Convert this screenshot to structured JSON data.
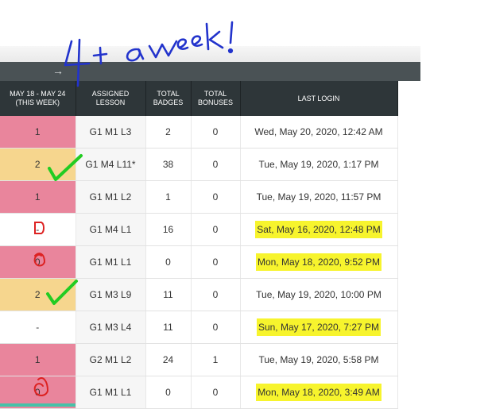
{
  "annotation": {
    "text": "4+ a week!"
  },
  "toolbar": {
    "arrow_icon": "→"
  },
  "table": {
    "headers": [
      "MAY 18 - MAY 24 (THIS WEEK)",
      "ASSIGNED LESSON",
      "TOTAL BADGES",
      "TOTAL BONUSES",
      "LAST LOGIN"
    ],
    "rows": [
      {
        "week": "1",
        "lesson": "G1 M1 L3",
        "badges": "2",
        "bonuses": "0",
        "login": "Wed, May 20, 2020, 12:42 AM",
        "color": "pink",
        "hl": false,
        "mark": ""
      },
      {
        "week": "2",
        "lesson": "G1 M4 L11*",
        "badges": "38",
        "bonuses": "0",
        "login": "Tue, May 19, 2020, 1:17 PM",
        "color": "gold",
        "hl": false,
        "mark": "check"
      },
      {
        "week": "1",
        "lesson": "G1 M1 L2",
        "badges": "1",
        "bonuses": "0",
        "login": "Tue, May 19, 2020, 11:57 PM",
        "color": "pink",
        "hl": false,
        "mark": ""
      },
      {
        "week": "-",
        "lesson": "G1 M4 L1",
        "badges": "16",
        "bonuses": "0",
        "login": "Sat, May 16, 2020, 12:48 PM",
        "color": "white",
        "hl": true,
        "mark": "zero"
      },
      {
        "week": "0",
        "lesson": "G1 M1 L1",
        "badges": "0",
        "bonuses": "0",
        "login": "Mon, May 18, 2020, 9:52 PM",
        "color": "pink",
        "hl": true,
        "mark": "zero"
      },
      {
        "week": "2",
        "lesson": "G1 M3 L9",
        "badges": "11",
        "bonuses": "0",
        "login": "Tue, May 19, 2020, 10:00 PM",
        "color": "gold",
        "hl": false,
        "mark": "check"
      },
      {
        "week": "-",
        "lesson": "G1 M3 L4",
        "badges": "11",
        "bonuses": "0",
        "login": "Sun, May 17, 2020, 7:27 PM",
        "color": "white",
        "hl": true,
        "mark": ""
      },
      {
        "week": "1",
        "lesson": "G2 M1 L2",
        "badges": "24",
        "bonuses": "1",
        "login": "Tue, May 19, 2020, 5:58 PM",
        "color": "pink",
        "hl": false,
        "mark": ""
      },
      {
        "week": "0",
        "lesson": "G1 M1 L1",
        "badges": "0",
        "bonuses": "0",
        "login": "Mon, May 18, 2020, 3:49 AM",
        "color": "pink",
        "hl": true,
        "mark": "zero"
      }
    ]
  },
  "colors": {
    "pink": "#e9859c",
    "gold": "#f6d68e",
    "header": "#2e3639",
    "highlight": "#f7f42d",
    "check": "#22cc22",
    "ink": "#2233cc",
    "redpen": "#dd2222"
  }
}
